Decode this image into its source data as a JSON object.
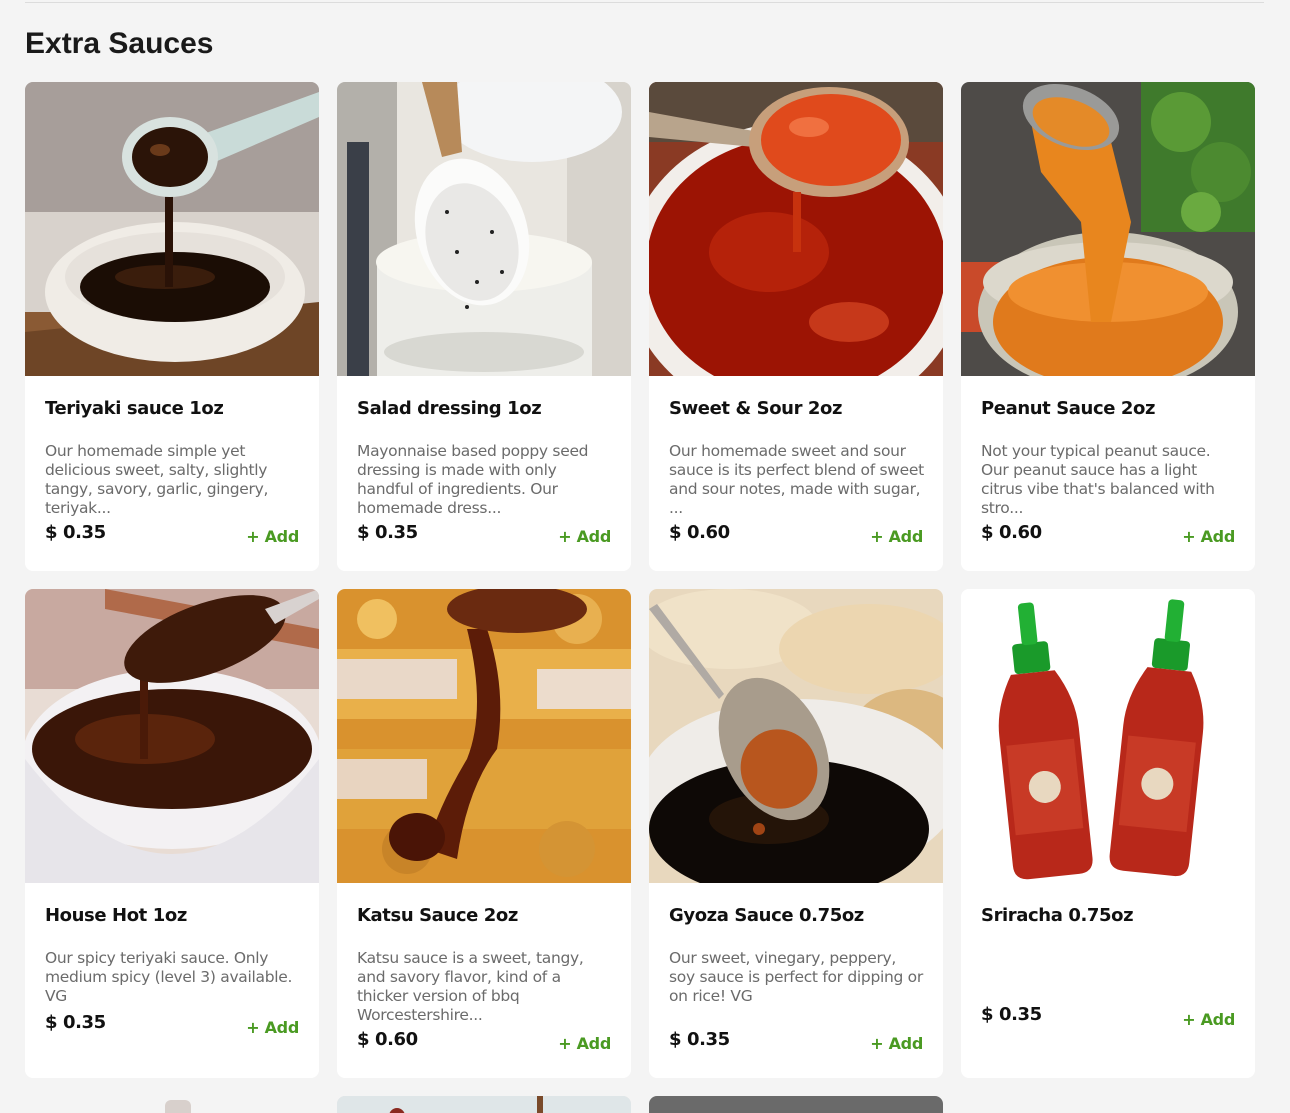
{
  "section": {
    "title": "Extra Sauces"
  },
  "items": [
    {
      "name": "Teriyaki sauce 1oz",
      "description": "Our homemade simple yet delicious sweet, salty, slightly tangy, savory, garlic, gingery, teriyak...",
      "price": "$ 0.35",
      "add_label": "+ Add"
    },
    {
      "name": "Salad dressing 1oz",
      "description": "Mayonnaise based poppy seed dressing is made with only handful of ingredients. Our homemade dress...",
      "price": "$ 0.35",
      "add_label": "+ Add"
    },
    {
      "name": "Sweet & Sour 2oz",
      "description": "Our homemade sweet and sour sauce is its perfect blend of sweet and sour notes, made with sugar, ...",
      "price": "$ 0.60",
      "add_label": "+ Add"
    },
    {
      "name": "Peanut Sauce 2oz",
      "description": "Not your typical peanut sauce. Our peanut sauce has a light citrus vibe that's balanced with stro...",
      "price": "$ 0.60",
      "add_label": "+ Add"
    },
    {
      "name": "House Hot 1oz",
      "description": "Our spicy teriyaki sauce. Only medium spicy (level 3) available. VG",
      "price": "$ 0.35",
      "add_label": "+ Add"
    },
    {
      "name": "Katsu Sauce 2oz",
      "description": "Katsu sauce is a sweet, tangy, and savory flavor, kind of a thicker version of bbq Worcestershire...",
      "price": "$ 0.60",
      "add_label": "+ Add"
    },
    {
      "name": "Gyoza Sauce 0.75oz",
      "description": "Our sweet, vinegary, peppery, soy sauce is perfect for dipping or on rice! VG",
      "price": "$ 0.35",
      "add_label": "+ Add"
    },
    {
      "name": "Sriracha 0.75oz",
      "description": "",
      "price": "$ 0.35",
      "add_label": "+ Add"
    }
  ],
  "colors": {
    "accent": "#4a9a22",
    "background": "#f4f4f4"
  }
}
